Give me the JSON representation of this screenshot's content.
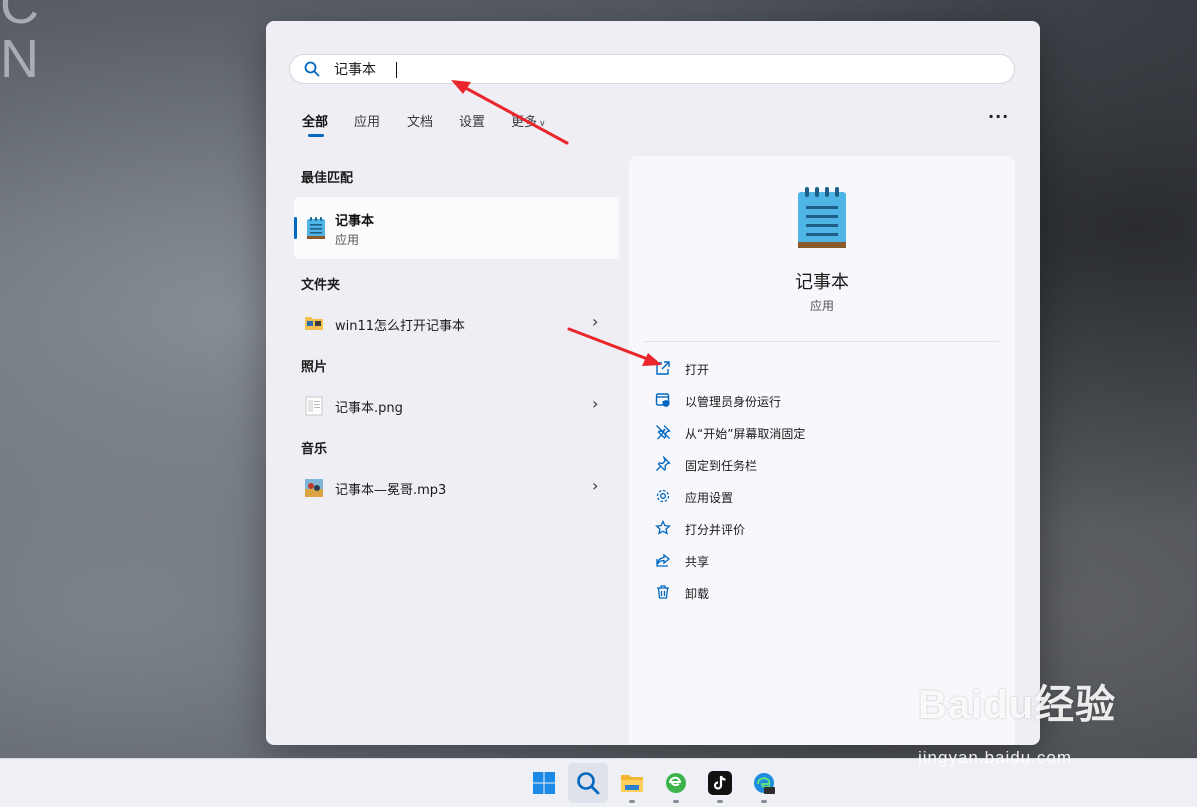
{
  "desktop": {
    "bg_text_top": "C",
    "bg_text": "N"
  },
  "search": {
    "value": "记事本",
    "placeholder": ""
  },
  "tabs": [
    {
      "label": "全部",
      "active": true
    },
    {
      "label": "应用"
    },
    {
      "label": "文档"
    },
    {
      "label": "设置"
    },
    {
      "label": "更多"
    }
  ],
  "more_menu_label": "···",
  "best_match": {
    "heading": "最佳匹配",
    "name": "记事本",
    "type": "应用"
  },
  "folders": {
    "heading": "文件夹",
    "items": [
      {
        "label": "win11怎么打开记事本"
      }
    ]
  },
  "photos": {
    "heading": "照片",
    "items": [
      {
        "label": "记事本.png"
      }
    ]
  },
  "music": {
    "heading": "音乐",
    "items": [
      {
        "label": "记事本—冕哥.mp3"
      }
    ]
  },
  "detail": {
    "name": "记事本",
    "type": "应用",
    "actions": [
      {
        "label": "打开",
        "icon": "open-external-icon"
      },
      {
        "label": "以管理员身份运行",
        "icon": "admin-shield-icon"
      },
      {
        "label": "从“开始”屏幕取消固定",
        "icon": "unpin-icon"
      },
      {
        "label": "固定到任务栏",
        "icon": "pin-icon"
      },
      {
        "label": "应用设置",
        "icon": "gear-icon"
      },
      {
        "label": "打分并评价",
        "icon": "star-icon"
      },
      {
        "label": "共享",
        "icon": "share-icon"
      },
      {
        "label": "卸载",
        "icon": "trash-icon"
      }
    ]
  },
  "taskbar": {
    "items": [
      "windows-start",
      "search",
      "file-explorer",
      "edge-green",
      "tiktok",
      "edge-dev"
    ]
  },
  "watermark": {
    "main": "Baidu经验",
    "sub": "jingyan.baidu.com"
  },
  "colors": {
    "accent": "#0067c0",
    "annotation": "#e8262b"
  }
}
